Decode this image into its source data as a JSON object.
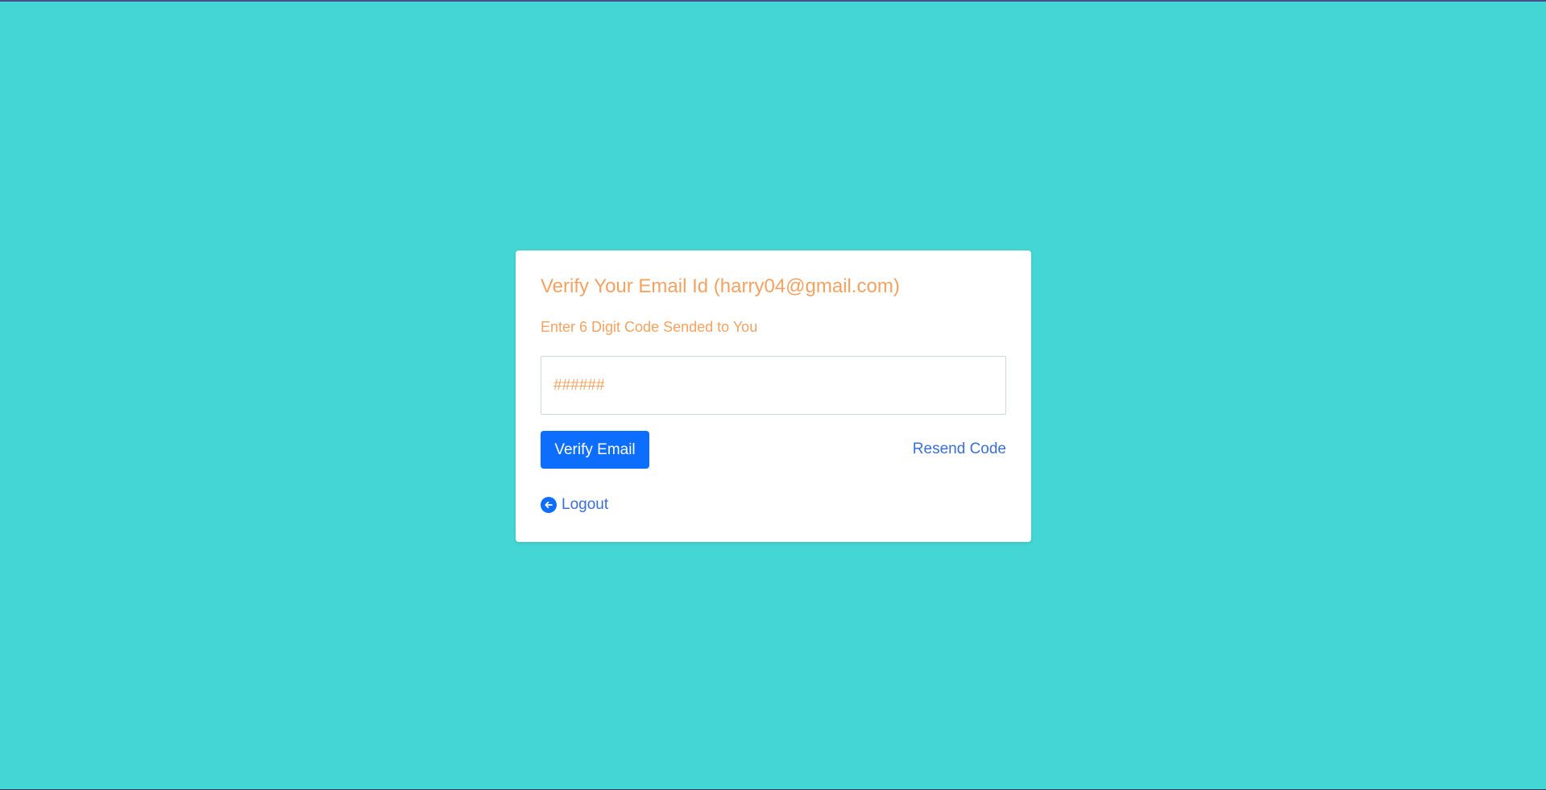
{
  "colors": {
    "background": "#44d5d5",
    "card": "#ffffff",
    "heading_text": "#f4a261",
    "primary_button": "#0d6efd",
    "link": "#3b6fd8"
  },
  "card": {
    "title": "Verify Your Email Id (harry04@gmail.com)",
    "subtitle": "Enter 6 Digit Code Sended to You",
    "code_input": {
      "value": "",
      "placeholder": "######"
    },
    "verify_button_label": "Verify Email",
    "resend_link_label": "Resend Code",
    "logout": {
      "icon": "arrow-left-circle-icon",
      "label": "Logout"
    }
  }
}
